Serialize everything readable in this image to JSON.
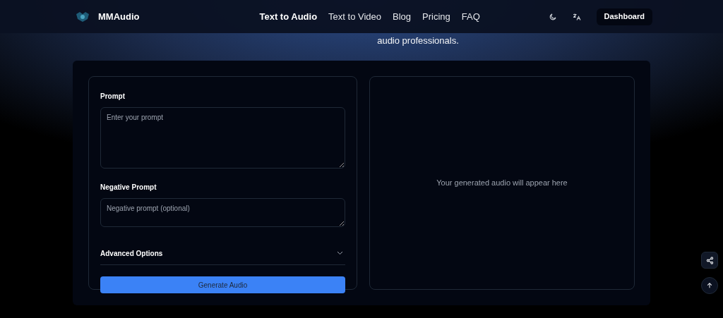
{
  "header": {
    "brand": "MMAudio",
    "nav": [
      {
        "label": "Text to Audio",
        "selected": true
      },
      {
        "label": "Text to Video",
        "selected": false
      },
      {
        "label": "Blog",
        "selected": false
      },
      {
        "label": "Pricing",
        "selected": false
      },
      {
        "label": "FAQ",
        "selected": false
      }
    ],
    "dashboard": "Dashboard"
  },
  "hero_subtitle": "audio professionals.",
  "form": {
    "prompt_label": "Prompt",
    "prompt_placeholder": "Enter your prompt",
    "negative_label": "Negative Prompt",
    "negative_placeholder": "Negative prompt (optional)",
    "advanced": {
      "label": "Advanced Options",
      "expanded": false
    },
    "generate": "Generate Audio"
  },
  "output": {
    "empty_message": "Your generated audio will appear here"
  }
}
